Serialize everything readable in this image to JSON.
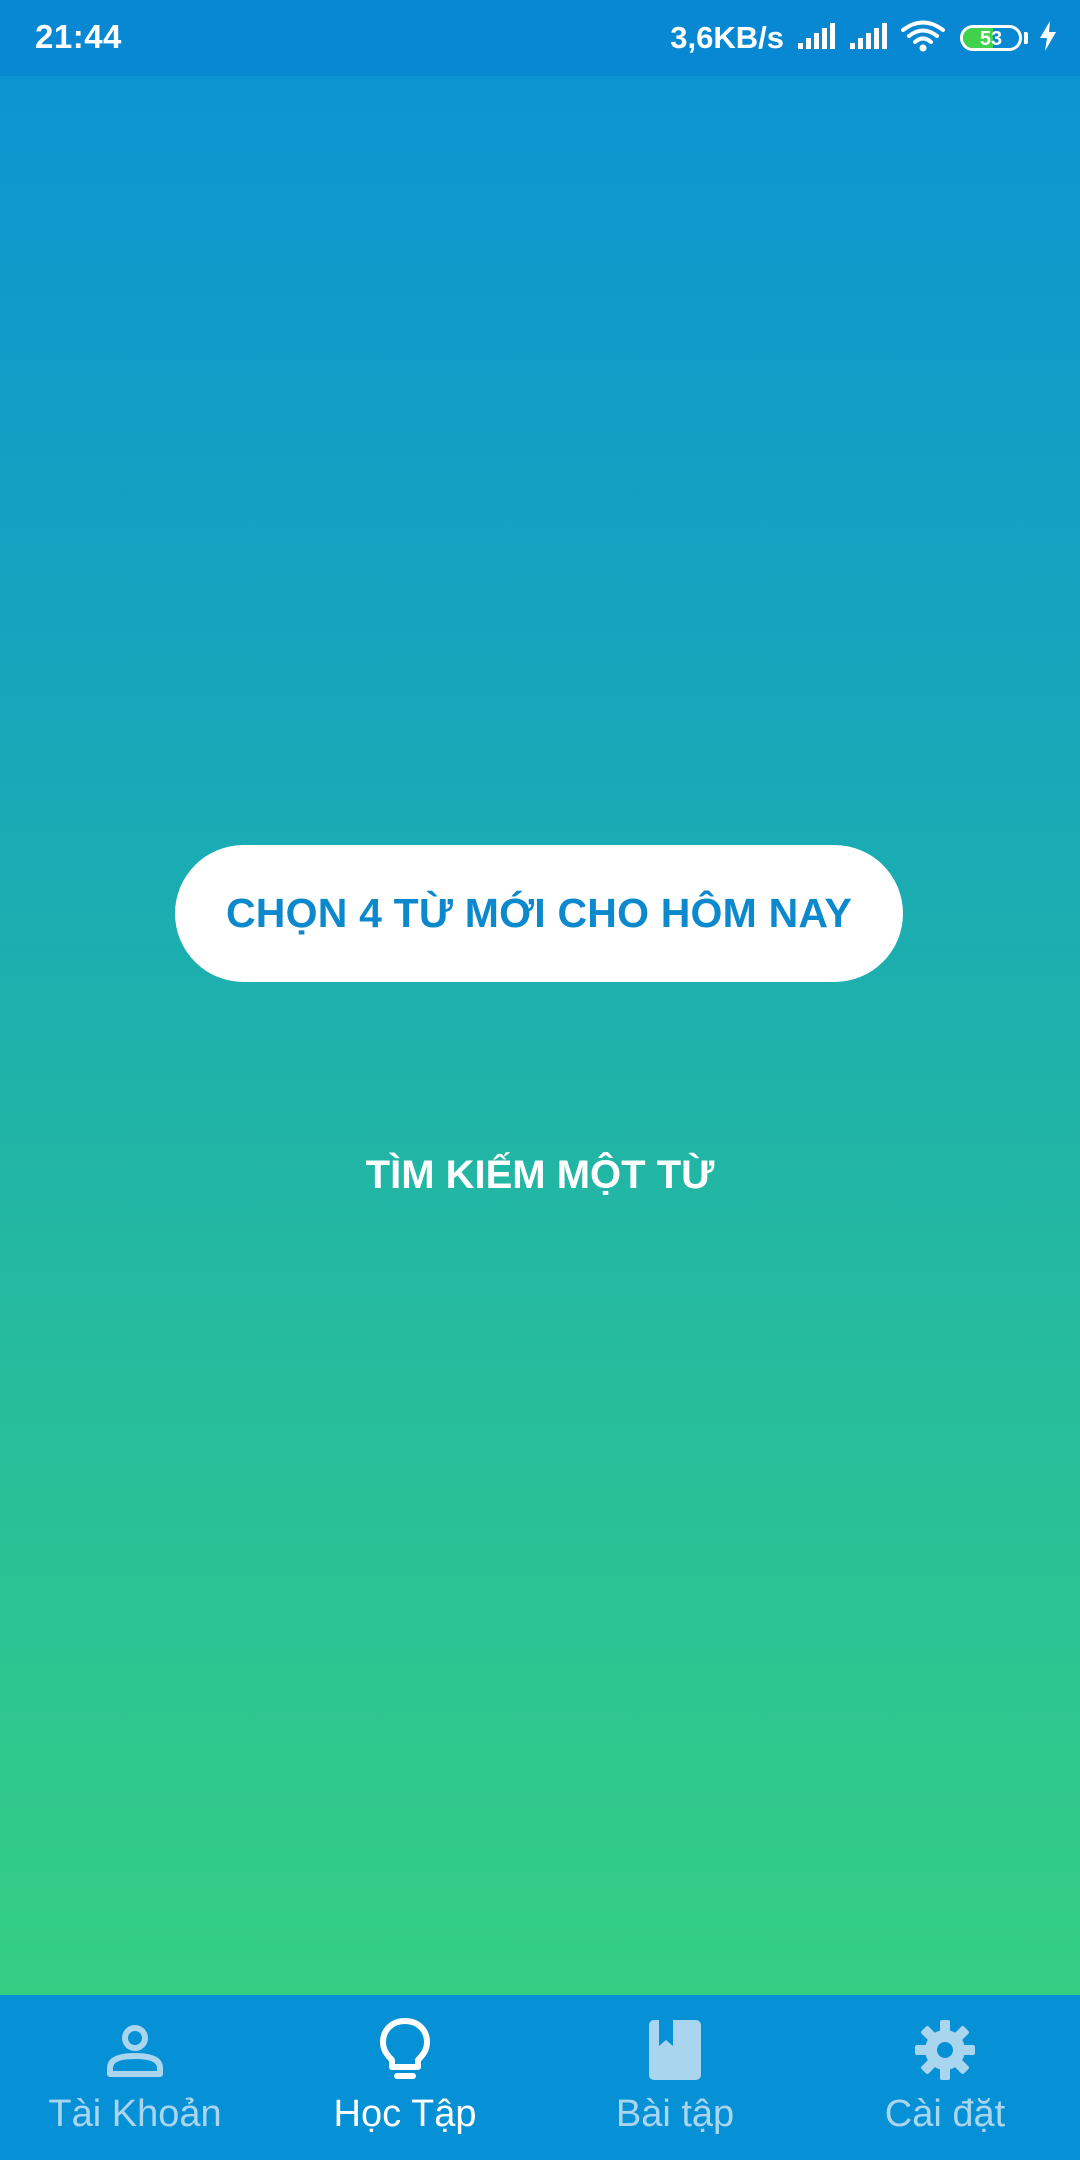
{
  "status_bar": {
    "time": "21:44",
    "net_speed": "3,6KB/s",
    "battery_level": "53",
    "battery_fraction": 0.53,
    "icons": [
      "signal-icon",
      "signal-icon",
      "wifi-icon",
      "battery-icon",
      "charging-bolt-icon"
    ]
  },
  "main": {
    "primary_action_label": "CHỌN 4 TỪ MỚI CHO HÔM NAY",
    "secondary_action_label": "TÌM KIẾM MỘT TỪ"
  },
  "bottom_nav": {
    "items": [
      {
        "label": "Tài Khoản",
        "icon": "account-icon",
        "active": false
      },
      {
        "label": "Học Tập",
        "icon": "lightbulb-icon",
        "active": true
      },
      {
        "label": "Bài tập",
        "icon": "book-icon",
        "active": false
      },
      {
        "label": "Cài đặt",
        "icon": "gear-icon",
        "active": false
      }
    ]
  },
  "colors": {
    "status_bar": "#0888d3",
    "gradient_top": "#0b92d4",
    "gradient_bottom": "#38d47c",
    "primary_text": "#0c88cc",
    "nav_background": "#0690d6",
    "nav_inactive": "#a9d6ee",
    "nav_active": "#ffffff"
  }
}
